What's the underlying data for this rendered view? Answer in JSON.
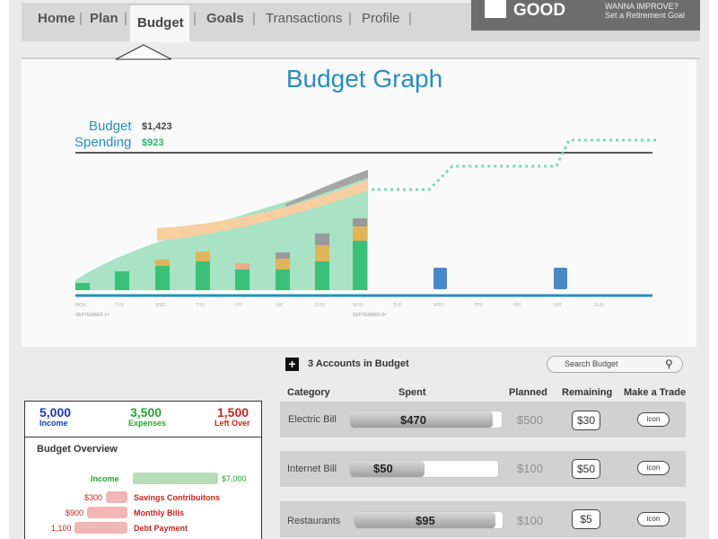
{
  "nav": {
    "home": "Home",
    "plan": "Plan",
    "budget": "Budget",
    "goals": "Goals",
    "transactions": "Transactions",
    "profile": "Profile",
    "sep": "|"
  },
  "status": {
    "label": "GOOD",
    "improve_line1": "WANNA IMPROVE?",
    "improve_line2": "Set a Retirement Goal"
  },
  "graph": {
    "title": "Budget Graph",
    "budget_label": "Budget",
    "budget_value": "$1,423",
    "spending_label": "Spending",
    "spending_value": "$923",
    "days": [
      "MON",
      "TUE",
      "WED",
      "THU",
      "FRI",
      "SAT",
      "SUN",
      "MON",
      "TUE",
      "WED",
      "THU",
      "FRI",
      "SAT",
      "SUN"
    ],
    "week1": "SEPTEMBER 1ˢᵗ",
    "week2": "SEPTEMBER 8ᵗʰ"
  },
  "accounts": {
    "plus_icon": "+",
    "title": "3 Accounts in Budget",
    "search_placeholder": "Search Budget",
    "columns": {
      "category": "Category",
      "spent": "Spent",
      "planned": "Planned",
      "remaining": "Remaining",
      "trade": "Make a Trade"
    },
    "rows": [
      {
        "category": "Electric Bill",
        "spent": "$470",
        "spent_fraction": 0.94,
        "planned": "$500",
        "remaining": "$30",
        "trade": "icon"
      },
      {
        "category": "Internet Bill",
        "spent": "$50",
        "spent_fraction": 0.5,
        "planned": "$100",
        "remaining": "$50",
        "trade": "icon"
      },
      {
        "category": "Restaurants",
        "spent": "$95",
        "spent_fraction": 0.95,
        "planned": "$100",
        "remaining": "$5",
        "trade": "icon"
      }
    ]
  },
  "summary": {
    "income_value": "5,000",
    "income_label": "Income",
    "expenses_value": "3,500",
    "expenses_label": "Expenses",
    "leftover_value": "1,500",
    "leftover_label": "Left Over",
    "overview_title": "Budget Overview",
    "income_row_label": "Income",
    "income_row_value": "$7,000",
    "items": [
      {
        "amount": "$300",
        "label": "Savings Contribuitons"
      },
      {
        "amount": "$900",
        "label": "Monthly Bills"
      },
      {
        "amount": "1,100",
        "label": "Debt Payment"
      }
    ]
  },
  "colors": {
    "accent": "#2a8dbd",
    "spending_green": "#27b36c",
    "income_blue": "#1a3bb3",
    "expenses_green": "#27a331",
    "leftover_red": "#c0281e",
    "area_green": "#a9e2c4",
    "bar_green": "#3bc07a",
    "band_peach": "#f8cfa1",
    "band_gray": "#a5a5a5",
    "future_blue": "#4a88cc",
    "dotted": "#7cd6b4"
  }
}
